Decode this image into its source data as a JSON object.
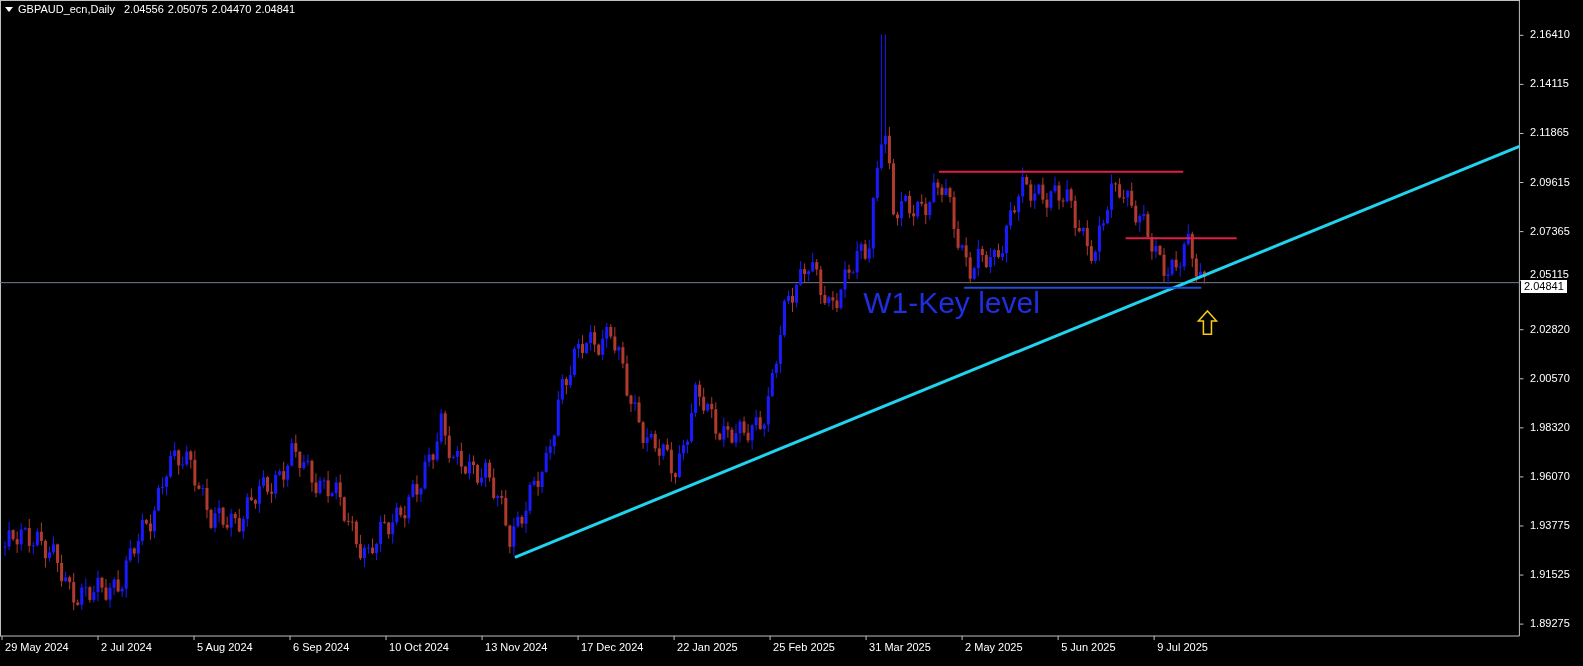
{
  "header": {
    "symbol": "GBPAUD_ecn,Daily",
    "ohlc": [
      "2.04556",
      "2.05075",
      "2.04470",
      "2.04841"
    ]
  },
  "price_axis": [
    "2.16410",
    "2.14115",
    "2.11865",
    "2.09615",
    "2.07365",
    "2.05115",
    "2.02820",
    "2.00570",
    "1.98320",
    "1.96070",
    "1.93775",
    "1.91525",
    "1.89275"
  ],
  "current_price": "2.04841",
  "date_axis": [
    "29 May 2024",
    "2 Jul 2024",
    "5 Aug 2024",
    "6 Sep 2024",
    "10 Oct 2024",
    "13 Nov 2024",
    "17 Dec 2024",
    "22 Jan 2025",
    "25 Feb 2025",
    "31 Mar 2025",
    "2 May 2025",
    "5 Jun 2025",
    "9 Jul 2025"
  ],
  "annotation": "W1-Key level"
}
